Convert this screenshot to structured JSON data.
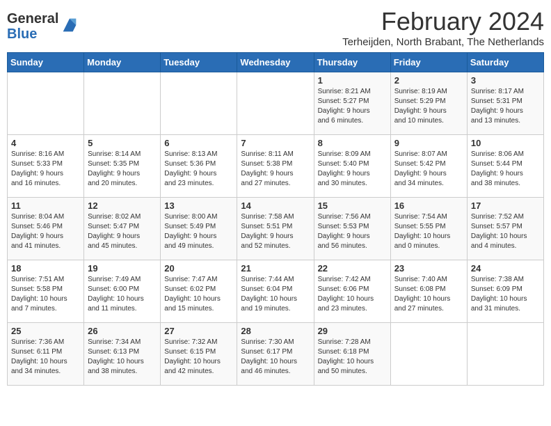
{
  "logo": {
    "general": "General",
    "blue": "Blue"
  },
  "title": "February 2024",
  "subtitle": "Terheijden, North Brabant, The Netherlands",
  "weekdays": [
    "Sunday",
    "Monday",
    "Tuesday",
    "Wednesday",
    "Thursday",
    "Friday",
    "Saturday"
  ],
  "weeks": [
    [
      {
        "day": "",
        "info": ""
      },
      {
        "day": "",
        "info": ""
      },
      {
        "day": "",
        "info": ""
      },
      {
        "day": "",
        "info": ""
      },
      {
        "day": "1",
        "info": "Sunrise: 8:21 AM\nSunset: 5:27 PM\nDaylight: 9 hours\nand 6 minutes."
      },
      {
        "day": "2",
        "info": "Sunrise: 8:19 AM\nSunset: 5:29 PM\nDaylight: 9 hours\nand 10 minutes."
      },
      {
        "day": "3",
        "info": "Sunrise: 8:17 AM\nSunset: 5:31 PM\nDaylight: 9 hours\nand 13 minutes."
      }
    ],
    [
      {
        "day": "4",
        "info": "Sunrise: 8:16 AM\nSunset: 5:33 PM\nDaylight: 9 hours\nand 16 minutes."
      },
      {
        "day": "5",
        "info": "Sunrise: 8:14 AM\nSunset: 5:35 PM\nDaylight: 9 hours\nand 20 minutes."
      },
      {
        "day": "6",
        "info": "Sunrise: 8:13 AM\nSunset: 5:36 PM\nDaylight: 9 hours\nand 23 minutes."
      },
      {
        "day": "7",
        "info": "Sunrise: 8:11 AM\nSunset: 5:38 PM\nDaylight: 9 hours\nand 27 minutes."
      },
      {
        "day": "8",
        "info": "Sunrise: 8:09 AM\nSunset: 5:40 PM\nDaylight: 9 hours\nand 30 minutes."
      },
      {
        "day": "9",
        "info": "Sunrise: 8:07 AM\nSunset: 5:42 PM\nDaylight: 9 hours\nand 34 minutes."
      },
      {
        "day": "10",
        "info": "Sunrise: 8:06 AM\nSunset: 5:44 PM\nDaylight: 9 hours\nand 38 minutes."
      }
    ],
    [
      {
        "day": "11",
        "info": "Sunrise: 8:04 AM\nSunset: 5:46 PM\nDaylight: 9 hours\nand 41 minutes."
      },
      {
        "day": "12",
        "info": "Sunrise: 8:02 AM\nSunset: 5:47 PM\nDaylight: 9 hours\nand 45 minutes."
      },
      {
        "day": "13",
        "info": "Sunrise: 8:00 AM\nSunset: 5:49 PM\nDaylight: 9 hours\nand 49 minutes."
      },
      {
        "day": "14",
        "info": "Sunrise: 7:58 AM\nSunset: 5:51 PM\nDaylight: 9 hours\nand 52 minutes."
      },
      {
        "day": "15",
        "info": "Sunrise: 7:56 AM\nSunset: 5:53 PM\nDaylight: 9 hours\nand 56 minutes."
      },
      {
        "day": "16",
        "info": "Sunrise: 7:54 AM\nSunset: 5:55 PM\nDaylight: 10 hours\nand 0 minutes."
      },
      {
        "day": "17",
        "info": "Sunrise: 7:52 AM\nSunset: 5:57 PM\nDaylight: 10 hours\nand 4 minutes."
      }
    ],
    [
      {
        "day": "18",
        "info": "Sunrise: 7:51 AM\nSunset: 5:58 PM\nDaylight: 10 hours\nand 7 minutes."
      },
      {
        "day": "19",
        "info": "Sunrise: 7:49 AM\nSunset: 6:00 PM\nDaylight: 10 hours\nand 11 minutes."
      },
      {
        "day": "20",
        "info": "Sunrise: 7:47 AM\nSunset: 6:02 PM\nDaylight: 10 hours\nand 15 minutes."
      },
      {
        "day": "21",
        "info": "Sunrise: 7:44 AM\nSunset: 6:04 PM\nDaylight: 10 hours\nand 19 minutes."
      },
      {
        "day": "22",
        "info": "Sunrise: 7:42 AM\nSunset: 6:06 PM\nDaylight: 10 hours\nand 23 minutes."
      },
      {
        "day": "23",
        "info": "Sunrise: 7:40 AM\nSunset: 6:08 PM\nDaylight: 10 hours\nand 27 minutes."
      },
      {
        "day": "24",
        "info": "Sunrise: 7:38 AM\nSunset: 6:09 PM\nDaylight: 10 hours\nand 31 minutes."
      }
    ],
    [
      {
        "day": "25",
        "info": "Sunrise: 7:36 AM\nSunset: 6:11 PM\nDaylight: 10 hours\nand 34 minutes."
      },
      {
        "day": "26",
        "info": "Sunrise: 7:34 AM\nSunset: 6:13 PM\nDaylight: 10 hours\nand 38 minutes."
      },
      {
        "day": "27",
        "info": "Sunrise: 7:32 AM\nSunset: 6:15 PM\nDaylight: 10 hours\nand 42 minutes."
      },
      {
        "day": "28",
        "info": "Sunrise: 7:30 AM\nSunset: 6:17 PM\nDaylight: 10 hours\nand 46 minutes."
      },
      {
        "day": "29",
        "info": "Sunrise: 7:28 AM\nSunset: 6:18 PM\nDaylight: 10 hours\nand 50 minutes."
      },
      {
        "day": "",
        "info": ""
      },
      {
        "day": "",
        "info": ""
      }
    ]
  ]
}
